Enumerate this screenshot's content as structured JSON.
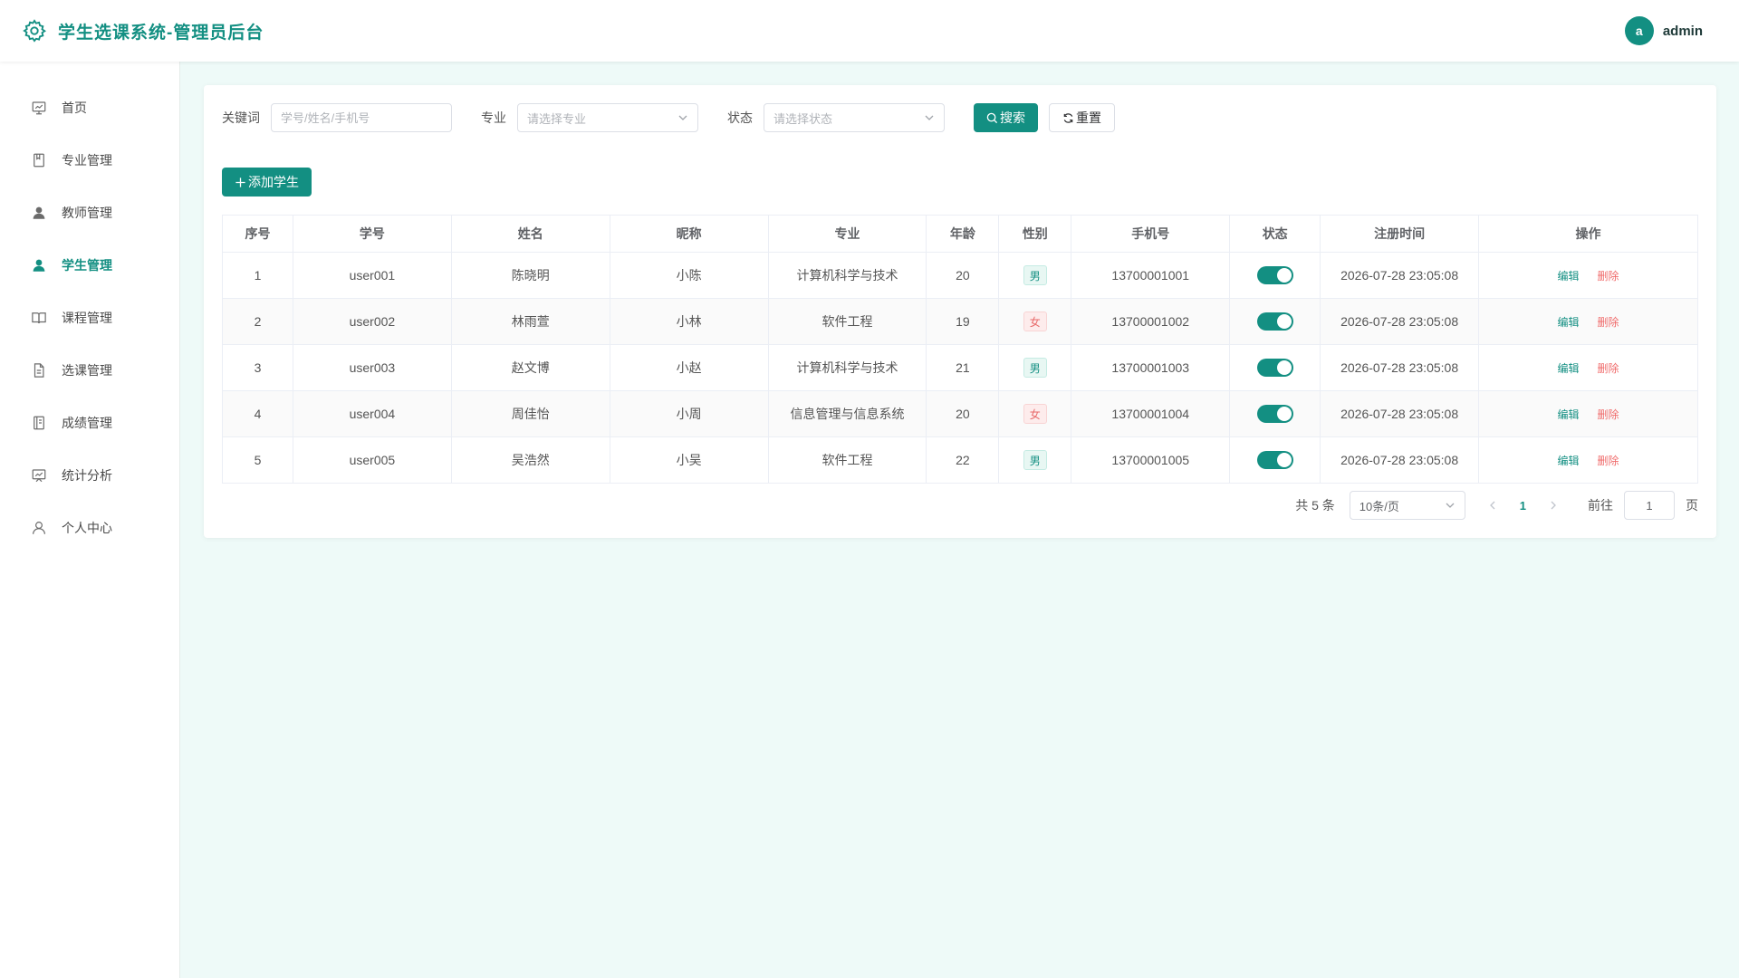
{
  "header": {
    "title": "学生选课系统-管理员后台",
    "avatar_letter": "a",
    "username": "admin"
  },
  "sidebar": {
    "items": [
      {
        "label": "首页",
        "icon": "dashboard-icon"
      },
      {
        "label": "专业管理",
        "icon": "book-icon"
      },
      {
        "label": "教师管理",
        "icon": "user-filled-icon"
      },
      {
        "label": "学生管理",
        "icon": "user-filled-icon",
        "active": true
      },
      {
        "label": "课程管理",
        "icon": "open-book-icon"
      },
      {
        "label": "选课管理",
        "icon": "document-icon"
      },
      {
        "label": "成绩管理",
        "icon": "notebook-icon"
      },
      {
        "label": "统计分析",
        "icon": "chart-icon"
      },
      {
        "label": "个人中心",
        "icon": "user-outline-icon"
      }
    ]
  },
  "filters": {
    "keyword_label": "关键词",
    "keyword_placeholder": "学号/姓名/手机号",
    "major_label": "专业",
    "major_placeholder": "请选择专业",
    "status_label": "状态",
    "status_placeholder": "请选择状态",
    "search_label": "搜索",
    "reset_label": "重置"
  },
  "add_button_label": "添加学生",
  "table": {
    "headers": [
      "序号",
      "学号",
      "姓名",
      "昵称",
      "专业",
      "年龄",
      "性别",
      "手机号",
      "状态",
      "注册时间",
      "操作"
    ],
    "rows": [
      {
        "no": "1",
        "id": "user001",
        "name": "陈晓明",
        "nick": "小陈",
        "major": "计算机科学与技术",
        "age": "20",
        "gender": "男",
        "phone": "13700001001",
        "enabled": true,
        "time": "2026-07-28 23:05:08"
      },
      {
        "no": "2",
        "id": "user002",
        "name": "林雨萱",
        "nick": "小林",
        "major": "软件工程",
        "age": "19",
        "gender": "女",
        "phone": "13700001002",
        "enabled": true,
        "time": "2026-07-28 23:05:08"
      },
      {
        "no": "3",
        "id": "user003",
        "name": "赵文博",
        "nick": "小赵",
        "major": "计算机科学与技术",
        "age": "21",
        "gender": "男",
        "phone": "13700001003",
        "enabled": true,
        "time": "2026-07-28 23:05:08"
      },
      {
        "no": "4",
        "id": "user004",
        "name": "周佳怡",
        "nick": "小周",
        "major": "信息管理与信息系统",
        "age": "20",
        "gender": "女",
        "phone": "13700001004",
        "enabled": true,
        "time": "2026-07-28 23:05:08"
      },
      {
        "no": "5",
        "id": "user005",
        "name": "吴浩然",
        "nick": "小吴",
        "major": "软件工程",
        "age": "22",
        "gender": "男",
        "phone": "13700001005",
        "enabled": true,
        "time": "2026-07-28 23:05:08"
      }
    ],
    "edit_label": "编辑",
    "delete_label": "删除"
  },
  "pagination": {
    "total_text": "共 5 条",
    "page_size": "10条/页",
    "current_page": "1",
    "goto_label": "前往",
    "goto_value": "1",
    "page_suffix": "页"
  },
  "colors": {
    "primary": "#138f82",
    "danger": "#f06b6b",
    "background": "#eefaf8"
  }
}
